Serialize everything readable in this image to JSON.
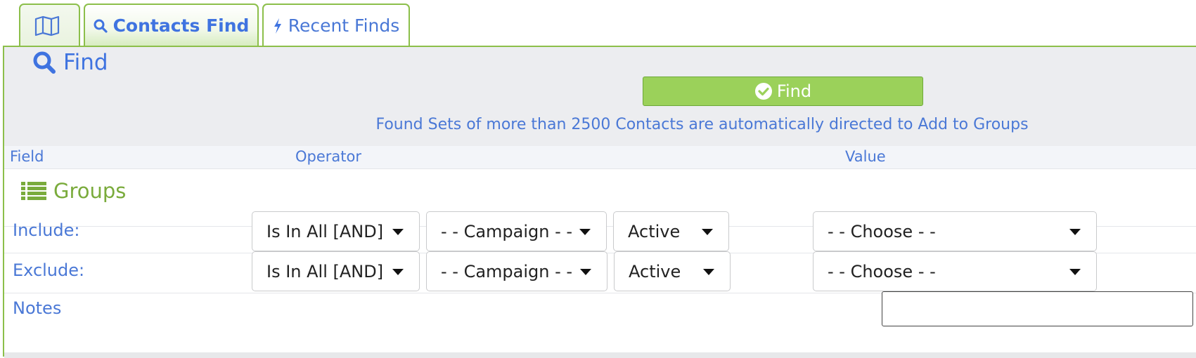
{
  "tabs": {
    "map": {
      "icon": "map-icon"
    },
    "contacts_find": {
      "label": "Contacts Find",
      "icon": "search-icon"
    },
    "recent_finds": {
      "label": "Recent Finds",
      "icon": "bolt-icon"
    }
  },
  "panel": {
    "title": "Find",
    "find_button": "Find",
    "notice": "Found Sets of more than 2500 Contacts are automatically directed to Add to Groups"
  },
  "columns": {
    "field": "Field",
    "operator": "Operator",
    "value": "Value"
  },
  "groups_section": {
    "title": "Groups",
    "icon": "list-icon"
  },
  "rows": [
    {
      "label": "Include:",
      "operator": "Is In All [AND]",
      "type": "- - Campaign - -",
      "status": "Active",
      "value": "- - Choose - -"
    },
    {
      "label": "Exclude:",
      "operator": "Is In All [AND]",
      "type": "- - Campaign - -",
      "status": "Active",
      "value": "- - Choose - -"
    }
  ],
  "notes": {
    "label": "Notes",
    "value": ""
  },
  "colors": {
    "accent_green": "#9bd15a",
    "link_blue": "#4a78d6",
    "section_green": "#7aab3c"
  }
}
